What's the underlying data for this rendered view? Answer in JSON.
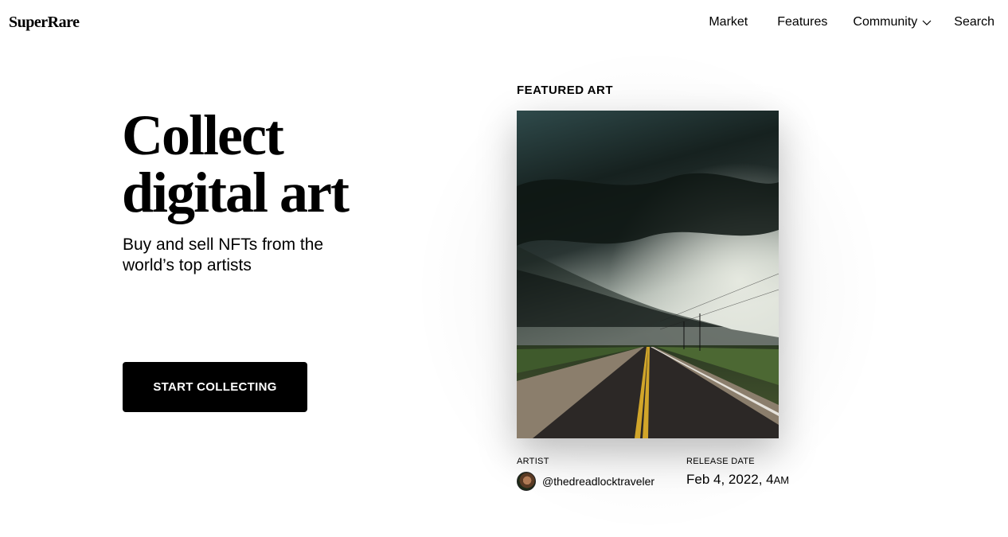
{
  "brand": {
    "logo": "SuperRare"
  },
  "nav": {
    "items": [
      {
        "label": "Market"
      },
      {
        "label": "Features"
      },
      {
        "label": "Community",
        "icon": "chevron-down-icon"
      },
      {
        "label": "Search"
      }
    ]
  },
  "hero": {
    "title_line1": "Collect",
    "title_line2": "digital art",
    "subtitle": "Buy and sell NFTs from the world’s top artists",
    "cta": "START COLLECTING"
  },
  "featured": {
    "label": "FEATURED ART",
    "artist_label": "ARTIST",
    "artist_handle": "@thedreadlocktraveler",
    "release_label": "RELEASE DATE",
    "release_date": "Feb 4, 2022, 4",
    "release_ampm": "AM"
  }
}
